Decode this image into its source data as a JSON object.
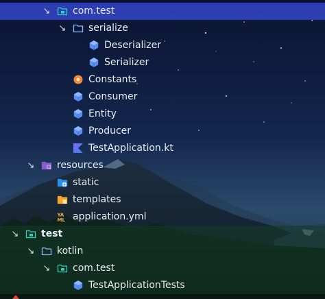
{
  "tree": {
    "rows": [
      {
        "name": "package-com-test",
        "label": "com.test",
        "indent": 1,
        "expanded": true,
        "icon": "package-folder-icon",
        "selected": true
      },
      {
        "name": "folder-serialize",
        "label": "serialize",
        "indent": 2,
        "expanded": true,
        "icon": "folder-icon"
      },
      {
        "name": "class-deserializer",
        "label": "Deserializer",
        "indent": 3,
        "icon": "kotlin-class-icon"
      },
      {
        "name": "class-serializer",
        "label": "Serializer",
        "indent": 3,
        "icon": "kotlin-class-icon"
      },
      {
        "name": "object-constants",
        "label": "Constants",
        "indent": 2,
        "icon": "kotlin-object-icon"
      },
      {
        "name": "class-consumer",
        "label": "Consumer",
        "indent": 2,
        "icon": "kotlin-class-icon"
      },
      {
        "name": "class-entity",
        "label": "Entity",
        "indent": 2,
        "icon": "kotlin-class-icon"
      },
      {
        "name": "class-producer",
        "label": "Producer",
        "indent": 2,
        "icon": "kotlin-class-icon"
      },
      {
        "name": "file-testapplication-kt",
        "label": "TestApplication.kt",
        "indent": 2,
        "icon": "kotlin-file-icon"
      },
      {
        "name": "folder-resources",
        "label": "resources",
        "indent": 0,
        "expanded": true,
        "icon": "resources-folder-icon"
      },
      {
        "name": "folder-static",
        "label": "static",
        "indent": 1,
        "icon": "web-folder-icon"
      },
      {
        "name": "folder-templates",
        "label": "templates",
        "indent": 1,
        "icon": "templates-folder-icon"
      },
      {
        "name": "file-application-yml",
        "label": "application.yml",
        "indent": 1,
        "icon": "yaml-file-icon"
      },
      {
        "name": "folder-test",
        "label": "test",
        "indent": -1,
        "expanded": true,
        "icon": "test-folder-icon",
        "bold": true
      },
      {
        "name": "folder-kotlin",
        "label": "kotlin",
        "indent": 0,
        "expanded": true,
        "icon": "folder-icon"
      },
      {
        "name": "package-com-test-tests",
        "label": "com.test",
        "indent": 1,
        "expanded": true,
        "icon": "package-folder-icon"
      },
      {
        "name": "class-testapplicationtests",
        "label": "TestApplicationTests",
        "indent": 2,
        "icon": "kotlin-class-icon"
      }
    ]
  },
  "colors": {
    "selection": "#3448cd",
    "folder_outline": "#8fb8ff",
    "package_folder": "#2fd0c0",
    "kotlin_class": "#5a8ff0",
    "kotlin_object": "#ef8a3a",
    "resources_folder": "#8a5cc8",
    "web_folder": "#2f8fe6",
    "templates_folder": "#f4a62a",
    "yaml": "#e3b34a"
  }
}
